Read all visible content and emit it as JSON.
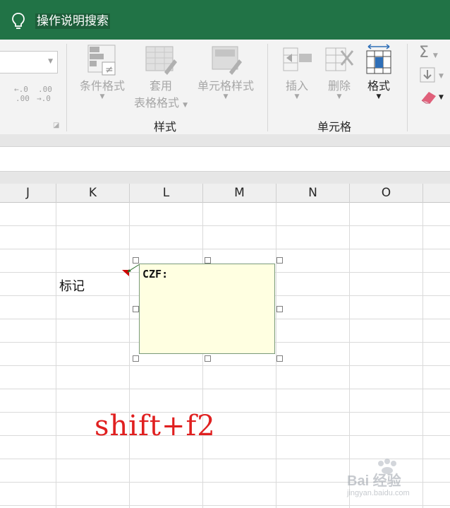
{
  "titlebar": {
    "tell_me": "操作说明搜索"
  },
  "ribbon": {
    "number": {
      "increase_decimal": "←.0\n.00",
      "decrease_decimal": ".00\n→.0"
    },
    "styles": {
      "conditional_formatting": "条件格式",
      "format_as_table_1": "套用",
      "format_as_table_2": "表格格式",
      "cell_styles": "单元格样式",
      "group_label": "样式"
    },
    "cells": {
      "insert": "插入",
      "delete": "删除",
      "format": "格式",
      "group_label": "单元格"
    },
    "editing": {
      "sum_symbol": "Σ"
    }
  },
  "columns": [
    "J",
    "K",
    "L",
    "M",
    "N",
    "O"
  ],
  "sheet": {
    "cell_k4": "标记",
    "comment": {
      "author": "CZF:"
    }
  },
  "annotation": {
    "text": "shift+f2"
  },
  "watermark": {
    "brand": "Bai 经验",
    "url": "jingyan.baidu.com"
  },
  "colors": {
    "titlebar": "#217346",
    "ribbon_bg": "#f3f3f3",
    "comment_bg": "#ffffe1",
    "annotation": "#e02020",
    "comment_flag": "#d00000"
  }
}
